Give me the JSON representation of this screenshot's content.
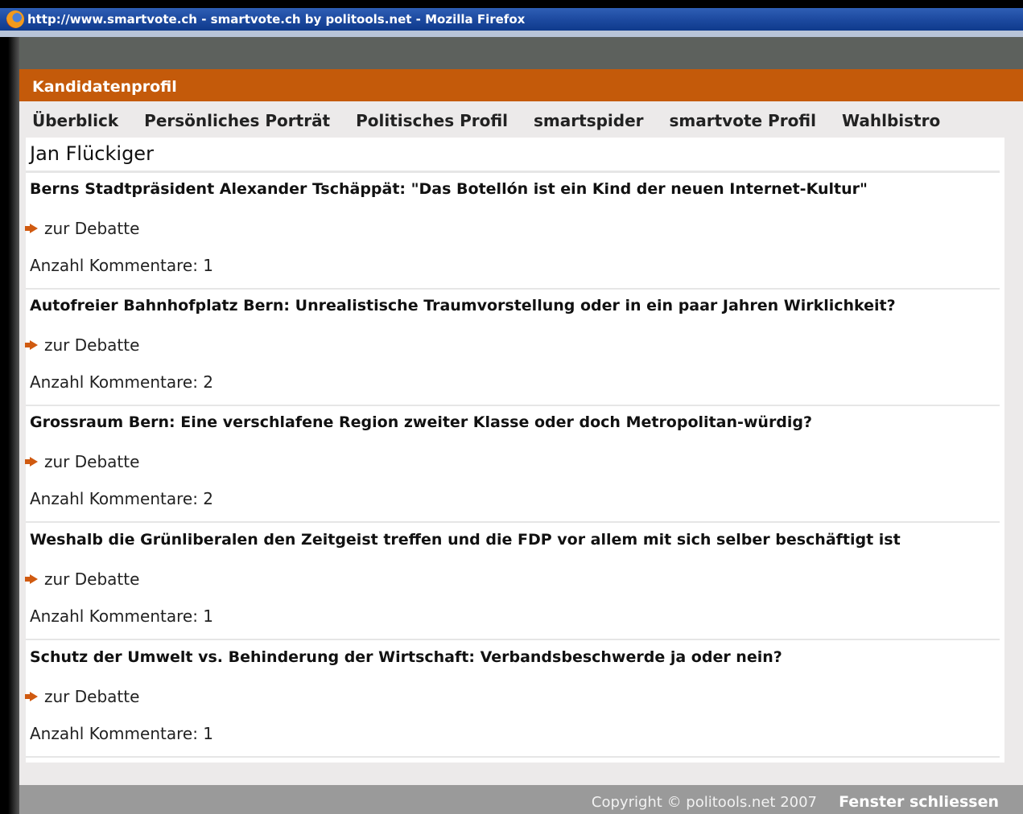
{
  "window": {
    "title": "http://www.smartvote.ch - smartvote.ch by politools.net - Mozilla Firefox"
  },
  "header": {
    "title": "Kandidatenprofil"
  },
  "tabs": [
    {
      "label": "Überblick"
    },
    {
      "label": "Persönliches Porträt"
    },
    {
      "label": "Politisches Profil"
    },
    {
      "label": "smartspider"
    },
    {
      "label": "smartvote Profil"
    },
    {
      "label": "Wahlbistro"
    }
  ],
  "candidate": {
    "name": "Jan Flückiger"
  },
  "debates": [
    {
      "title": "Berns Stadtpräsident Alexander Tschäppät: \"Das Botellón ist ein Kind der neuen Internet-Kultur\"",
      "link": "zur Debatte",
      "comments": "Anzahl Kommentare: 1"
    },
    {
      "title": "Autofreier Bahnhofplatz Bern: Unrealistische Traumvorstellung oder in ein paar Jahren Wirklichkeit?",
      "link": "zur Debatte",
      "comments": "Anzahl Kommentare: 2"
    },
    {
      "title": "Grossraum Bern: Eine verschlafene Region zweiter Klasse oder doch Metropolitan-würdig?",
      "link": "zur Debatte",
      "comments": "Anzahl Kommentare: 2"
    },
    {
      "title": "Weshalb die Grünliberalen den Zeitgeist treffen und die FDP vor allem mit sich selber beschäftigt ist",
      "link": "zur Debatte",
      "comments": "Anzahl Kommentare: 1"
    },
    {
      "title": "Schutz der Umwelt vs. Behinderung der Wirtschaft: Verbandsbeschwerde ja oder nein?",
      "link": "zur Debatte",
      "comments": "Anzahl Kommentare: 1"
    }
  ],
  "footer": {
    "copyright": "Copyright © politools.net 2007",
    "close_label": "Fenster schliessen"
  },
  "colors": {
    "accent": "#c45a0a",
    "arrow": "#d05a10",
    "footer": "#9a9a9a"
  }
}
